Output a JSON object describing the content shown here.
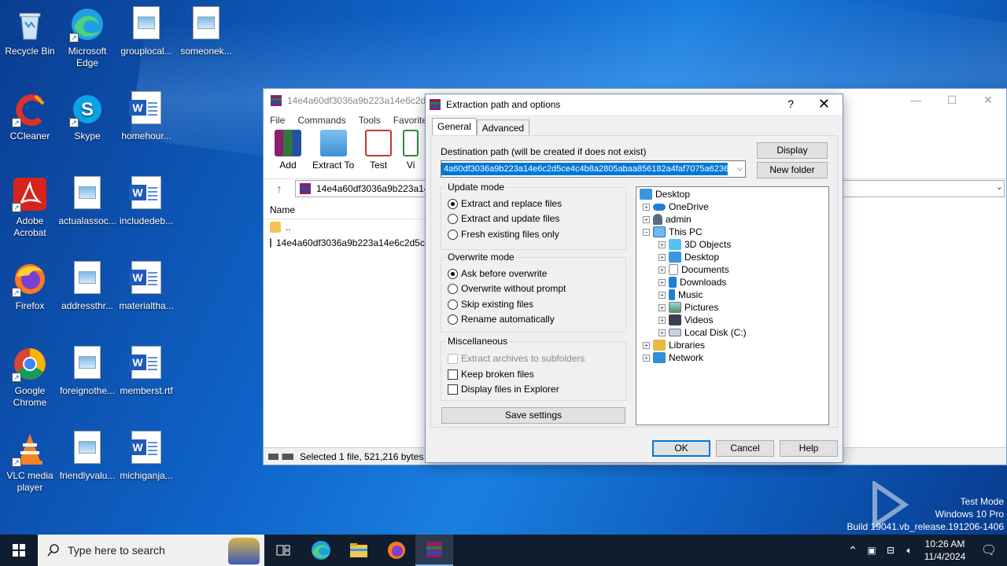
{
  "desktop": {
    "icons": [
      {
        "label": "Recycle Bin"
      },
      {
        "label": "Microsoft Edge"
      },
      {
        "label": "grouplocal..."
      },
      {
        "label": "someonek..."
      },
      {
        "label": "CCleaner"
      },
      {
        "label": "Skype"
      },
      {
        "label": "homehour..."
      },
      {
        "label": "Adobe Acrobat"
      },
      {
        "label": "actualassoc..."
      },
      {
        "label": "includedeb..."
      },
      {
        "label": "Firefox"
      },
      {
        "label": "addressthr..."
      },
      {
        "label": "materialtha..."
      },
      {
        "label": "Google Chrome"
      },
      {
        "label": "foreignothe..."
      },
      {
        "label": "memberst.rtf"
      },
      {
        "label": "VLC media player"
      },
      {
        "label": "friendlyvalu..."
      },
      {
        "label": "michiganja..."
      }
    ]
  },
  "winrar": {
    "title": "14e4a60df3036a9b223a14e6c2d5c",
    "menu": [
      "File",
      "Commands",
      "Tools",
      "Favorites"
    ],
    "toolbar": [
      "Add",
      "Extract To",
      "Test",
      "Vi"
    ],
    "address": "14e4a60df3036a9b223a14",
    "list_header": "Name",
    "rows": [
      "..",
      "14e4a60df3036a9b223a14e6c2d5ce"
    ],
    "status": "Selected 1 file, 521,216 bytes"
  },
  "dialog": {
    "title": "Extraction path and options",
    "help": "?",
    "close": "✕",
    "tabs": [
      "General",
      "Advanced"
    ],
    "dest_label": "Destination path (will be created if does not exist)",
    "dest_value": "4a60df3036a9b223a14e6c2d5ce4c4b8a2805abaa856182a4faf7075a6236",
    "display_btn": "Display",
    "new_folder_btn": "New folder",
    "update_mode": {
      "title": "Update mode",
      "options": [
        "Extract and replace files",
        "Extract and update files",
        "Fresh existing files only"
      ],
      "selected": 0
    },
    "overwrite_mode": {
      "title": "Overwrite mode",
      "options": [
        "Ask before overwrite",
        "Overwrite without prompt",
        "Skip existing files",
        "Rename automatically"
      ],
      "selected": 0
    },
    "misc": {
      "title": "Miscellaneous",
      "options": [
        "Extract archives to subfolders",
        "Keep broken files",
        "Display files in Explorer"
      ]
    },
    "save_btn": "Save settings",
    "tree": [
      "Desktop",
      "OneDrive",
      "admin",
      "This PC",
      "3D Objects",
      "Desktop",
      "Documents",
      "Downloads",
      "Music",
      "Pictures",
      "Videos",
      "Local Disk (C:)",
      "Libraries",
      "Network"
    ],
    "ok": "OK",
    "cancel": "Cancel",
    "help_btn": "Help"
  },
  "taskbar": {
    "search_placeholder": "Type here to search",
    "time": "10:26 AM",
    "date": "11/4/2024"
  },
  "watermark": {
    "logo": "ANY RUN",
    "line1": "Test Mode",
    "line2": "Windows 10 Pro",
    "line3": "Build 19041.vb_release.191206-1406"
  }
}
